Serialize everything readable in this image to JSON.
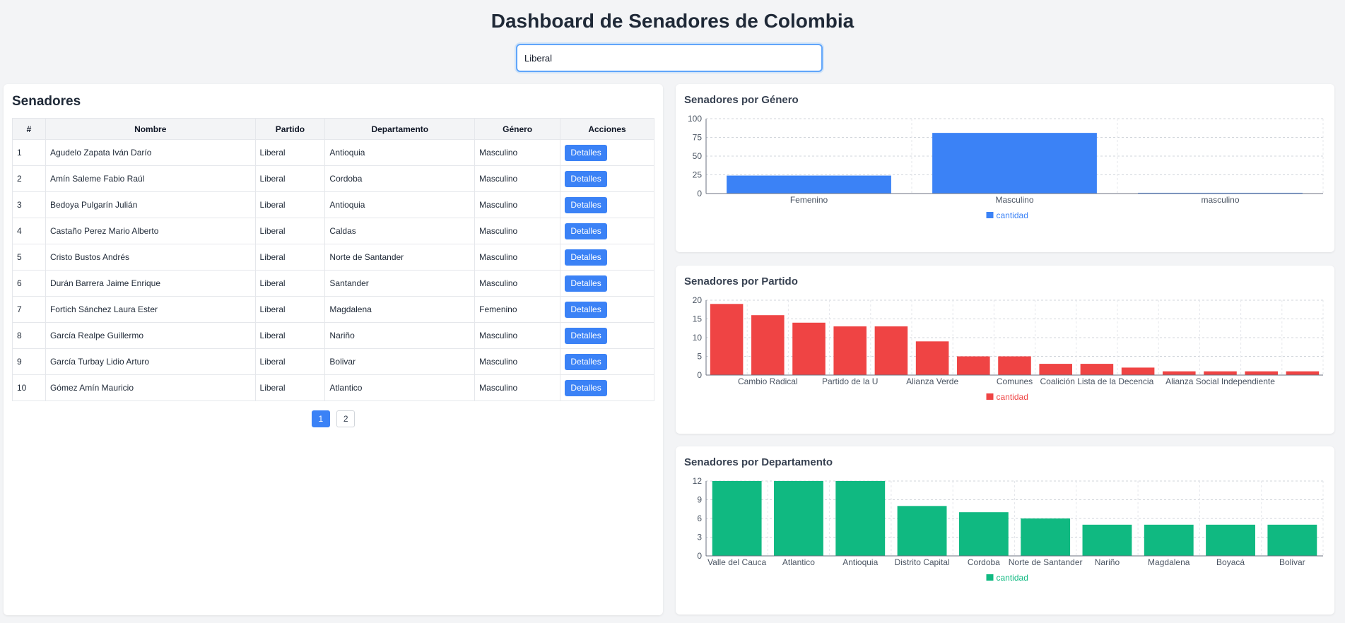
{
  "header": {
    "title": "Dashboard de Senadores de Colombia"
  },
  "search": {
    "value": "Liberal"
  },
  "table_panel": {
    "title": "Senadores",
    "columns": [
      "#",
      "Nombre",
      "Partido",
      "Departamento",
      "Género",
      "Acciones"
    ],
    "action_label": "Detalles",
    "rows": [
      [
        "1",
        "Agudelo Zapata Iván Darío",
        "Liberal",
        "Antioquia",
        "Masculino"
      ],
      [
        "2",
        "Amín Saleme Fabio Raúl",
        "Liberal",
        "Cordoba",
        "Masculino"
      ],
      [
        "3",
        "Bedoya Pulgarín Julián",
        "Liberal",
        "Antioquia",
        "Masculino"
      ],
      [
        "4",
        "Castaño Perez Mario Alberto",
        "Liberal",
        "Caldas",
        "Masculino"
      ],
      [
        "5",
        "Cristo Bustos Andrés",
        "Liberal",
        "Norte de Santander",
        "Masculino"
      ],
      [
        "6",
        "Durán Barrera Jaime Enrique",
        "Liberal",
        "Santander",
        "Masculino"
      ],
      [
        "7",
        "Fortich Sánchez Laura Ester",
        "Liberal",
        "Magdalena",
        "Femenino"
      ],
      [
        "8",
        "García Realpe Guillermo",
        "Liberal",
        "Nariño",
        "Masculino"
      ],
      [
        "9",
        "García Turbay Lidio Arturo",
        "Liberal",
        "Bolivar",
        "Masculino"
      ],
      [
        "10",
        "Gómez Amín Mauricio",
        "Liberal",
        "Atlantico",
        "Masculino"
      ]
    ],
    "pages": [
      "1",
      "2"
    ],
    "current_page": "1"
  },
  "chart_data": [
    {
      "type": "bar",
      "title": "Senadores por Género",
      "categories": [
        "Femenino",
        "Masculino",
        "masculino"
      ],
      "series": [
        {
          "name": "cantidad",
          "values": [
            24,
            81,
            1
          ]
        }
      ],
      "ylim": [
        0,
        100
      ],
      "yticks": [
        0,
        25,
        50,
        75,
        100
      ],
      "xtick_labels": [
        "Femenino",
        "Masculino",
        "masculino"
      ],
      "color": "#3b82f6",
      "grid": true,
      "legend": "bottom"
    },
    {
      "type": "bar",
      "title": "Senadores por Partido",
      "categories": [
        "",
        "Cambio Radical",
        "",
        "Partido de la U",
        "",
        "Alianza Verde",
        "",
        "Comunes",
        "",
        "Coalición Lista de la Decencia",
        "",
        "",
        "Alianza Social Independiente",
        "",
        ""
      ],
      "series": [
        {
          "name": "cantidad",
          "values": [
            19,
            16,
            14,
            13,
            13,
            9,
            5,
            5,
            3,
            3,
            2,
            1,
            1,
            1,
            1
          ]
        }
      ],
      "ylim": [
        0,
        20
      ],
      "yticks": [
        0,
        5,
        10,
        15,
        20
      ],
      "xtick_labels": [
        "Cambio Radical",
        "Partido de la U",
        "Alianza Verde",
        "Comunes",
        "Coalición Lista de la Decencia",
        "Alianza Social Independiente"
      ],
      "color": "#ef4444",
      "grid": true,
      "legend": "bottom"
    },
    {
      "type": "bar",
      "title": "Senadores por Departamento",
      "categories": [
        "Valle del Cauca",
        "Atlantico",
        "Antioquia",
        "Distrito Capital",
        "Cordoba",
        "Norte de Santander",
        "Nariño",
        "Magdalena",
        "Boyacá",
        "Bolivar"
      ],
      "series": [
        {
          "name": "cantidad",
          "values": [
            12,
            12,
            12,
            8,
            7,
            6,
            5,
            5,
            5,
            5
          ]
        }
      ],
      "ylim": [
        0,
        12
      ],
      "yticks": [
        0,
        3,
        6,
        9,
        12
      ],
      "xtick_labels": [
        "Valle del Cauca",
        "Atlantico",
        "Antioquia",
        "Distrito Capital",
        "Cordoba",
        "Norte de Santander",
        "Nariño",
        "Magdalena",
        "Boyacá",
        "Bolivar"
      ],
      "color": "#10b981",
      "grid": true,
      "legend": "bottom"
    }
  ]
}
